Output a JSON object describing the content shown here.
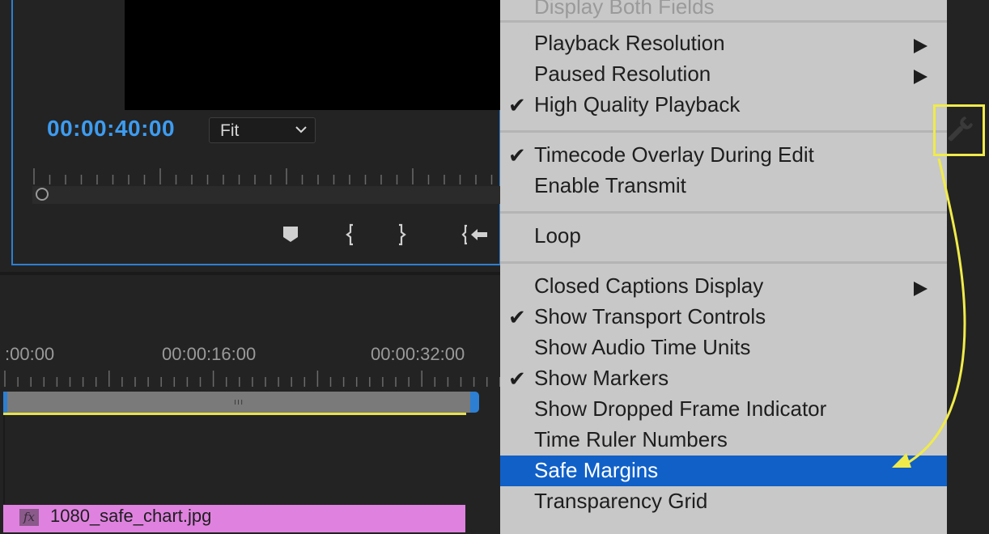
{
  "monitor": {
    "timecode": "00:00:40:00",
    "zoom_select": {
      "value": "Fit"
    }
  },
  "timeline": {
    "ruler_labels": [
      ":00:00",
      "00:00:16:00",
      "00:00:32:00"
    ],
    "clip": {
      "name": "1080_safe_chart.jpg",
      "fx_badge": "fx"
    }
  },
  "menu": {
    "items": [
      {
        "label": "Display Both Fields",
        "state": "disabled"
      },
      {
        "label": "Playback Resolution",
        "submenu": true
      },
      {
        "label": "Paused Resolution",
        "submenu": true
      },
      {
        "label": "High Quality Playback",
        "checked": true
      },
      {
        "label": "Timecode Overlay During Edit",
        "checked": true
      },
      {
        "label": "Enable Transmit"
      },
      {
        "label": "Loop"
      },
      {
        "label": "Closed Captions Display",
        "submenu": true
      },
      {
        "label": "Show Transport Controls",
        "checked": true
      },
      {
        "label": "Show Audio Time Units"
      },
      {
        "label": "Show Markers",
        "checked": true
      },
      {
        "label": "Show Dropped Frame Indicator"
      },
      {
        "label": "Time Ruler Numbers"
      },
      {
        "label": "Safe Margins",
        "state": "selected"
      },
      {
        "label": "Transparency Grid"
      }
    ],
    "check_glyph": "✔"
  },
  "icons": {
    "settings": "wrench-icon",
    "transport": [
      "add-marker-icon",
      "mark-in-icon",
      "mark-out-icon",
      "go-to-in-icon"
    ]
  },
  "colors": {
    "accent_blue": "#2d7fd3",
    "timecode_blue": "#3d9cf0",
    "highlight_yellow": "#f0eb4a",
    "menu_selected": "#1060c8",
    "clip_pink": "#df82df"
  }
}
